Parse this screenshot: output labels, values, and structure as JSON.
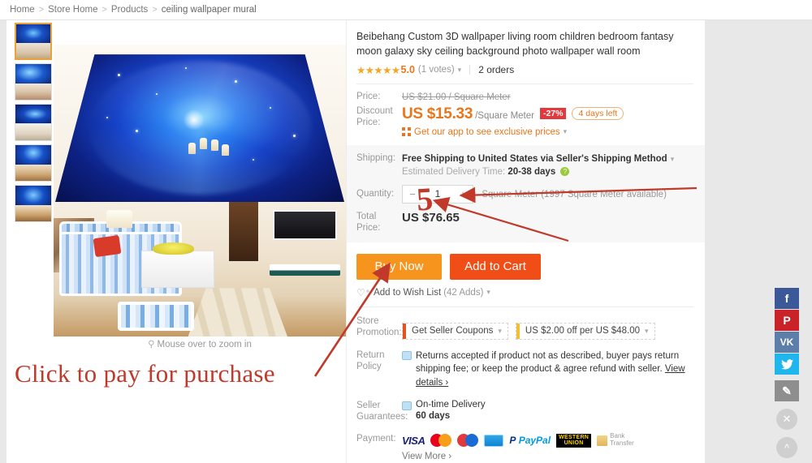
{
  "breadcrumb": {
    "items": [
      "Home",
      "Store Home",
      "Products"
    ],
    "current": "ceiling wallpaper mural",
    "separator": ">"
  },
  "gallery": {
    "zoom_caption": "Mouse over to zoom in",
    "zoom_icon": "magnifier-icon",
    "thumbnails": [
      {
        "label": "thumbnail-1",
        "selected": true
      },
      {
        "label": "thumbnail-2",
        "selected": false
      },
      {
        "label": "thumbnail-3",
        "selected": false
      },
      {
        "label": "thumbnail-4",
        "selected": false
      },
      {
        "label": "thumbnail-5",
        "selected": false
      }
    ]
  },
  "product": {
    "title": "Beibehang Custom 3D wallpaper living room children bedroom fantasy moon galaxy sky ceiling background photo wallpaper wall room",
    "stars": "★★★★★",
    "score": "5.0",
    "votes": "(1 votes)",
    "orders": "2 orders"
  },
  "price": {
    "label": "Price:",
    "original": "US $21.00 / Square Meter",
    "discount_label": "Discount Price:",
    "discount_value": "US $15.33",
    "unit": "/Square Meter",
    "discount_badge": "-27%",
    "time_left": "4 days left",
    "app_promo": "Get our app to see exclusive prices",
    "app_icon": "qr-code-icon",
    "accent_color": "#e8761c",
    "badge_color": "#e4393c"
  },
  "shipping": {
    "label": "Shipping:",
    "method": "Free Shipping to United States via Seller's Shipping Method",
    "estimate_prefix": "Estimated Delivery Time:",
    "estimate_value": "20-38 days",
    "help_icon": "question-mark-icon"
  },
  "quantity": {
    "label": "Quantity:",
    "minus": "−",
    "plus": "+",
    "value": "1",
    "unit": "Square Meter (1997 Square Meter available)"
  },
  "total": {
    "label": "Total Price:",
    "value": "US $76.65"
  },
  "actions": {
    "buy_now": "Buy Now",
    "add_to_cart": "Add to Cart",
    "buy_color": "#f7941e",
    "cart_color": "#f04e16",
    "wish_label": "Add to Wish List",
    "wish_count": "(42 Adds)",
    "wish_icon": "heart-plus-icon"
  },
  "store_promotion": {
    "label": "Store Promotion:",
    "items": [
      {
        "text": "Get Seller Coupons",
        "bar_color": "#e4531f"
      },
      {
        "text": "US $2.00 off per US $48.00",
        "bar_color": "#f0c032"
      }
    ]
  },
  "return_policy": {
    "label": "Return Policy",
    "text": "Returns accepted if product not as described, buyer pays return shipping fee; or keep the product & agree refund with seller.",
    "link": "View details ›",
    "icon": "return-box-icon"
  },
  "seller_guarantees": {
    "label": "Seller Guarantees:",
    "title": "On-time Delivery",
    "value": "60 days",
    "icon": "delivery-truck-icon"
  },
  "payment": {
    "label": "Payment:",
    "methods": [
      "VISA",
      "Mastercard",
      "UnionPay",
      "Maestro",
      "PayPal",
      "Western Union",
      "Bank Transfer"
    ],
    "paypal_text_1": "Pay",
    "paypal_text_2": "Pal",
    "western_union_1": "WESTERN",
    "western_union_2": "UNION",
    "bank_1": "Bank",
    "bank_2": "Transfer",
    "view_more": "View More ›"
  },
  "social": {
    "buttons": [
      {
        "name": "facebook",
        "glyph": "f",
        "color": "#3b5998"
      },
      {
        "name": "pinterest",
        "glyph": "P",
        "color": "#c92228"
      },
      {
        "name": "vk",
        "glyph": "VK",
        "color": "#5c7ea8"
      },
      {
        "name": "twitter",
        "glyph": "✦",
        "color": "#1fb6ee"
      },
      {
        "name": "edit",
        "glyph": "✎",
        "color": "#8e8e8e"
      }
    ],
    "close_glyph": "✕",
    "scrolltop_glyph": "^"
  },
  "annotations": {
    "instruction": "Click to pay for purchase",
    "quantity_marking": "5",
    "color": "#c0392b"
  }
}
